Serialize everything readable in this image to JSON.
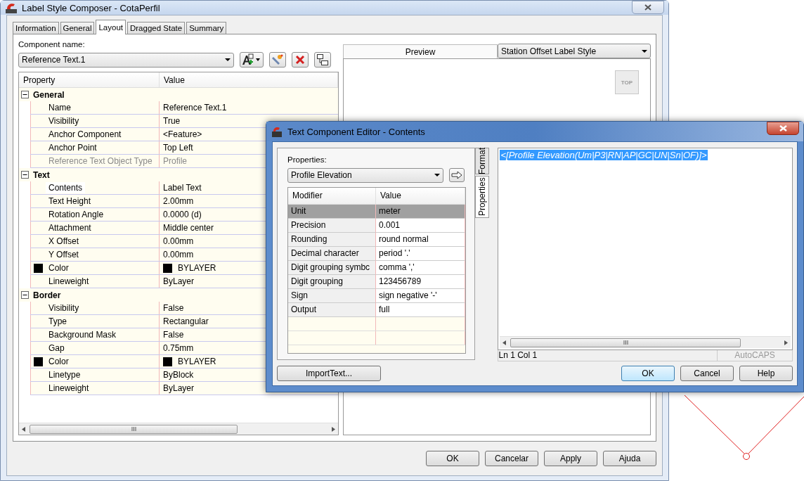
{
  "main_window": {
    "title": "Label Style Composer - CotaPerfil",
    "tabs": [
      {
        "label": "Information",
        "selected": false
      },
      {
        "label": "General",
        "selected": false
      },
      {
        "label": "Layout",
        "selected": true
      },
      {
        "label": "Dragged State",
        "selected": false
      },
      {
        "label": "Summary",
        "selected": false
      }
    ],
    "component_name": {
      "label": "Component name:",
      "value": "Reference Text.1"
    },
    "property_grid": {
      "columns": [
        "Property",
        "Value"
      ],
      "groups": [
        {
          "name": "General",
          "expanded": true,
          "rows": [
            {
              "property": "Name",
              "value": "Reference Text.1",
              "kind": "text",
              "disabled": false,
              "selected": false
            },
            {
              "property": "Visibility",
              "value": "True",
              "kind": "text",
              "disabled": false,
              "selected": false
            },
            {
              "property": "Anchor Component",
              "value": "<Feature>",
              "kind": "text",
              "disabled": false,
              "selected": false
            },
            {
              "property": "Anchor Point",
              "value": "Top Left",
              "kind": "text",
              "disabled": false,
              "selected": false
            },
            {
              "property": "Reference Text Object Type",
              "value": "Profile",
              "kind": "text",
              "disabled": true,
              "selected": false
            }
          ]
        },
        {
          "name": "Text",
          "expanded": true,
          "rows": [
            {
              "property": "Contents",
              "value": "Label Text",
              "kind": "text",
              "disabled": false,
              "selected": true
            },
            {
              "property": "Text Height",
              "value": "2.00mm",
              "kind": "text",
              "disabled": false,
              "selected": false
            },
            {
              "property": "Rotation Angle",
              "value": "0.0000 (d)",
              "kind": "text",
              "disabled": false,
              "selected": false
            },
            {
              "property": "Attachment",
              "value": "Middle center",
              "kind": "text",
              "disabled": false,
              "selected": false
            },
            {
              "property": "X Offset",
              "value": "0.00mm",
              "kind": "text",
              "disabled": false,
              "selected": false
            },
            {
              "property": "Y Offset",
              "value": "0.00mm",
              "kind": "text",
              "disabled": false,
              "selected": false
            },
            {
              "property": "Color",
              "value": "BYLAYER",
              "kind": "color",
              "disabled": false,
              "selected": false
            },
            {
              "property": "Lineweight",
              "value": "ByLayer",
              "kind": "text",
              "disabled": false,
              "selected": false
            }
          ]
        },
        {
          "name": "Border",
          "expanded": true,
          "rows": [
            {
              "property": "Visibility",
              "value": "False",
              "kind": "text",
              "disabled": false,
              "selected": false
            },
            {
              "property": "Type",
              "value": "Rectangular",
              "kind": "text",
              "disabled": false,
              "selected": false
            },
            {
              "property": "Background Mask",
              "value": "False",
              "kind": "text",
              "disabled": false,
              "selected": false
            },
            {
              "property": "Gap",
              "value": "0.75mm",
              "kind": "text",
              "disabled": false,
              "selected": false
            },
            {
              "property": "Color",
              "value": "BYLAYER",
              "kind": "color",
              "disabled": false,
              "selected": false
            },
            {
              "property": "Linetype",
              "value": "ByBlock",
              "kind": "text",
              "disabled": false,
              "selected": false
            },
            {
              "property": "Lineweight",
              "value": "ByLayer",
              "kind": "text",
              "disabled": false,
              "selected": false
            }
          ]
        }
      ]
    },
    "preview": {
      "tab_label": "Preview",
      "style_select": "Station Offset Label Style",
      "view_cube": "TOP"
    },
    "buttons": [
      "OK",
      "Cancelar",
      "Apply",
      "Ajuda"
    ]
  },
  "editor_dialog": {
    "title": "Text Component Editor - Contents",
    "properties": {
      "label": "Properties:",
      "value": "Profile Elevation"
    },
    "modifier_grid": {
      "columns": [
        "Modifier",
        "Value"
      ],
      "rows": [
        {
          "modifier": "Unit",
          "value": "meter",
          "selected": true
        },
        {
          "modifier": "Precision",
          "value": "0.001",
          "selected": false
        },
        {
          "modifier": "Rounding",
          "value": "round normal",
          "selected": false
        },
        {
          "modifier": "Decimal character",
          "value": "period '.'",
          "selected": false
        },
        {
          "modifier": "Digit grouping symbc",
          "value": "comma ','",
          "selected": false
        },
        {
          "modifier": "Digit grouping",
          "value": "123456789",
          "selected": false
        },
        {
          "modifier": "Sign",
          "value": "sign negative '-'",
          "selected": false
        },
        {
          "modifier": "Output",
          "value": "full",
          "selected": false
        }
      ]
    },
    "side_tabs": [
      {
        "label": "Format",
        "selected": false
      },
      {
        "label": "Properties",
        "selected": true
      }
    ],
    "contents": "<[Profile Elevation(Um|P3|RN|AP|GC|UN|Sn|OF)]>",
    "status": {
      "position": "Ln 1 Col 1",
      "mode": "AutoCAPS"
    },
    "import_button": "ImportText...",
    "buttons": [
      "OK",
      "Cancel",
      "Help"
    ]
  }
}
